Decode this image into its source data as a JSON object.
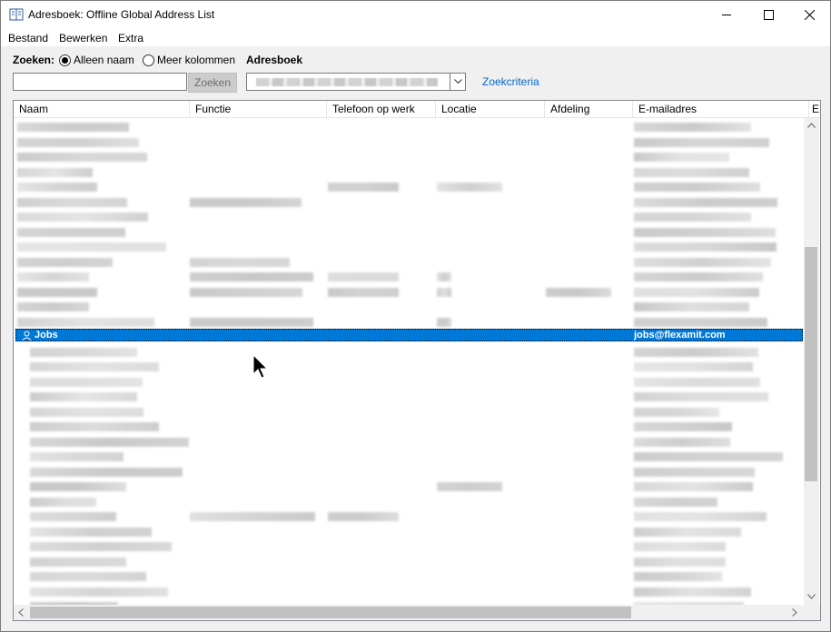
{
  "window": {
    "title": "Adresboek: Offline Global Address List",
    "minimize_glyph": "—",
    "maximize_glyph": "☐",
    "close_glyph": "✕"
  },
  "menu": [
    "Bestand",
    "Bewerken",
    "Extra"
  ],
  "search": {
    "label": "Zoeken:",
    "option_name": "Alleen naam",
    "option_more": "Meer kolommen",
    "addressbook_label": "Adresboek",
    "input_value": "",
    "button_label": "Zoeken",
    "criteria_link": "Zoekcriteria"
  },
  "columns": [
    "Naam",
    "Functie",
    "Telefoon op werk",
    "Locatie",
    "Afdeling",
    "E-mailadres",
    "E"
  ],
  "selected_row": {
    "name": "Jobs",
    "email": "jobs@flexamit.com"
  },
  "icons": {
    "app": "address-book-icon",
    "selected_row": "contact-icon",
    "dropdown": "chevron-down-icon",
    "scroll_up": "chevron-up-icon",
    "scroll_down": "chevron-down-icon",
    "scroll_left": "chevron-left-icon",
    "scroll_right": "chevron-right-icon",
    "cursor": "mouse-pointer-icon"
  },
  "colors": {
    "selection": "#0078d7",
    "link": "#0066cc"
  }
}
